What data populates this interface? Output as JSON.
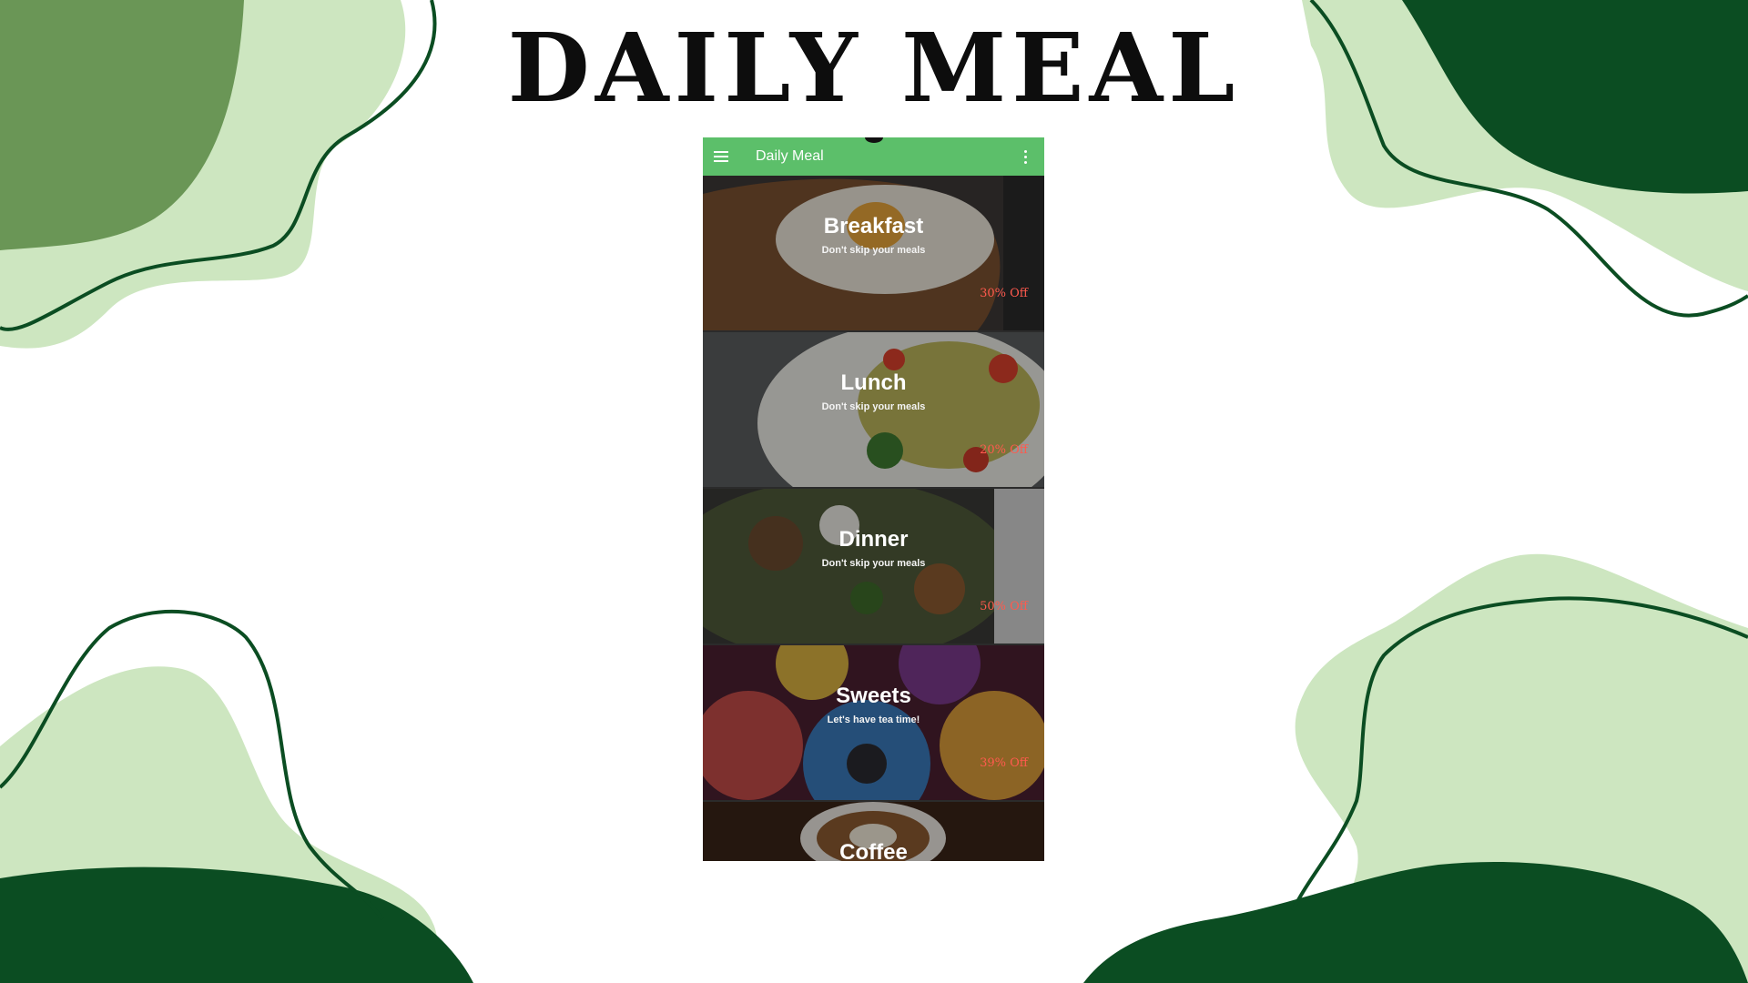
{
  "page": {
    "title": "DAILY MEAL"
  },
  "colors": {
    "dark_green": "#0b4d22",
    "mid_green": "#6a9656",
    "light_green": "#cde6c0",
    "app_bar_green": "#5cbf6a",
    "discount_red": "#ff5a4e"
  },
  "app": {
    "title": "Daily Meal",
    "menu_icon": "hamburger-menu-icon",
    "overflow_icon": "more-vertical-icon"
  },
  "categories": [
    {
      "title": "Breakfast",
      "subtitle": "Don't skip your meals",
      "discount": "30% Off"
    },
    {
      "title": "Lunch",
      "subtitle": "Don't skip your meals",
      "discount": "20% Off"
    },
    {
      "title": "Dinner",
      "subtitle": "Don't skip your meals",
      "discount": "50% Off"
    },
    {
      "title": "Sweets",
      "subtitle": "Let's have tea time!",
      "discount": "39% Off"
    },
    {
      "title": "Coffee"
    }
  ]
}
